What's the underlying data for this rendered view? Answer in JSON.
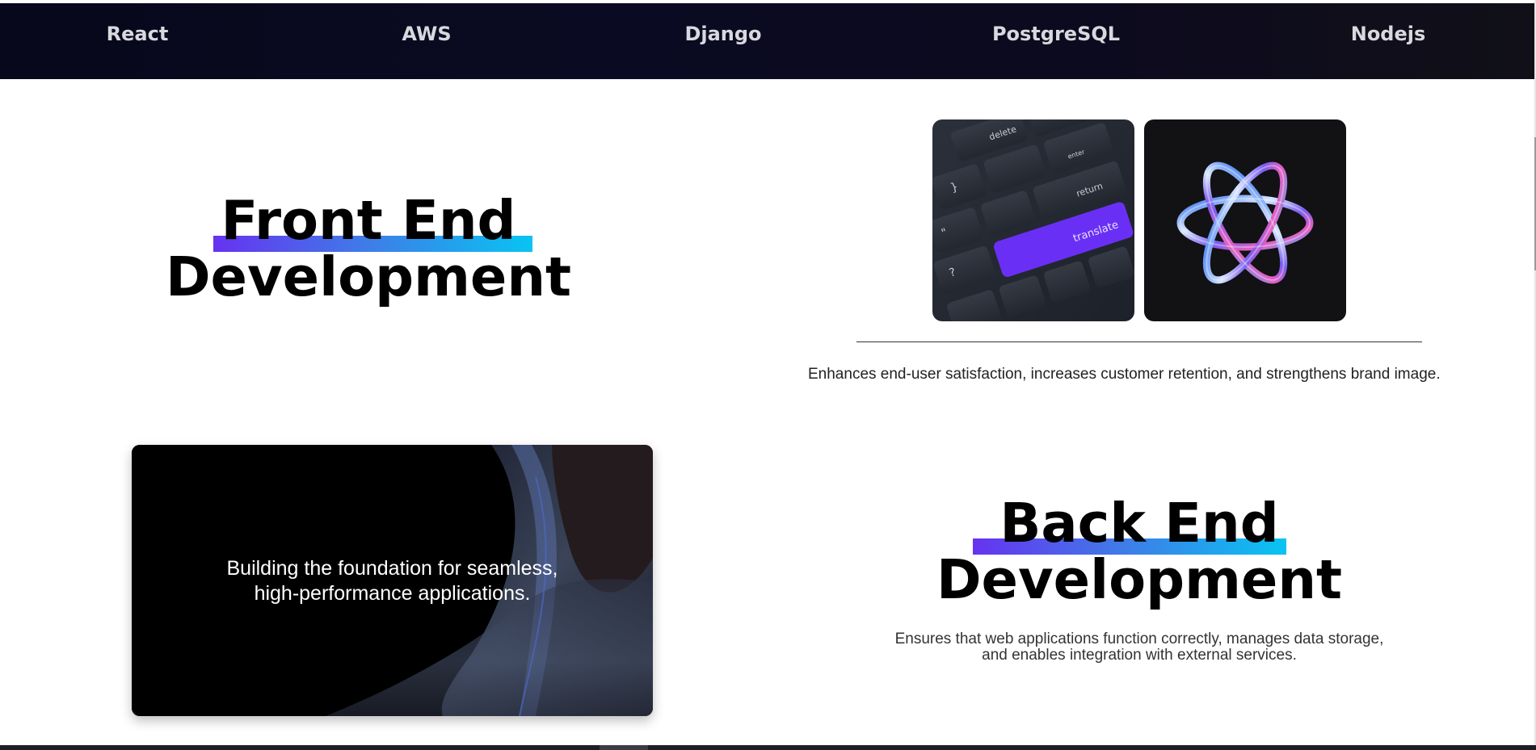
{
  "tech_bar": {
    "items": [
      {
        "label": "React"
      },
      {
        "label": "AWS"
      },
      {
        "label": "Django"
      },
      {
        "label": "PostgreSQL"
      },
      {
        "label": "Nodejs"
      }
    ]
  },
  "frontend": {
    "title_line1": "Front End",
    "title_line2": "Development",
    "description": "Enhances end-user satisfaction, increases customer retention, and strengthens brand image.",
    "images": [
      {
        "icon": "keyboard-image",
        "keys": [
          "delete",
          "enter",
          "return",
          "translate"
        ]
      },
      {
        "icon": "atom-image"
      }
    ]
  },
  "backend": {
    "title_line1": "Back End",
    "title_line2": "Development",
    "description_line1": "Ensures that web applications function correctly, manages data storage,",
    "description_line2": "and enables integration with external services.",
    "card_text_line1": "Building the foundation for seamless,",
    "card_text_line2": "high-performance applications."
  },
  "colors": {
    "nav_background": "#0a0a22",
    "accent_gradient_start": "#6633f0",
    "accent_gradient_end": "#08c4f2",
    "translate_key": "#6a2ff5"
  }
}
